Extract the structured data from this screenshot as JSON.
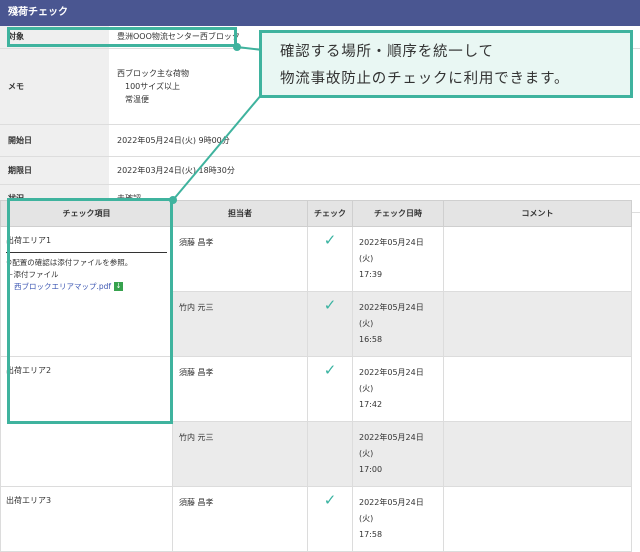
{
  "title": "殘荷チェック",
  "info": {
    "target_label": "対象",
    "target_value": "豊洲OOO物流センター西ブロック",
    "memo_label": "メモ",
    "memo_lines": [
      "西ブロック主な荷物",
      "100サイズ以上",
      "常温便"
    ],
    "start_label": "開始日",
    "start_value": "2022年05月24日(火) 9時00分",
    "due_label": "期限日",
    "due_value": "2022年03月24日(火) 18時30分",
    "status_label": "状況",
    "status_value": "未確認"
  },
  "callout": {
    "line1": "確認する場所・順序を統一して",
    "line2": "物流事故防止のチェックに利用できます。"
  },
  "table": {
    "headers": [
      "チェック項目",
      "担当者",
      "チェック",
      "チェック日時",
      "コメント"
    ],
    "check_glyph": "✓",
    "areas": [
      {
        "name": "出荷エリア1",
        "note": "※配置の確認は添付ファイルを参照。",
        "attach_label": "－添付ファイル",
        "attach_file": "西ブロックエリアマップ.pdf",
        "rows": [
          {
            "person": "須藤 昌孝",
            "checked": true,
            "date": "2022年05月24日(火)",
            "time": "17:39"
          },
          {
            "person": "竹内 元三",
            "checked": true,
            "date": "2022年05月24日(火)",
            "time": "16:58"
          }
        ]
      },
      {
        "name": "出荷エリア2",
        "rows": [
          {
            "person": "須藤 昌孝",
            "checked": true,
            "date": "2022年05月24日(火)",
            "time": "17:42"
          },
          {
            "person": "竹内 元三",
            "checked": false,
            "date": "2022年05月24日(火)",
            "time": "17:00"
          }
        ]
      },
      {
        "name": "出荷エリア3",
        "rows": [
          {
            "person": "須藤 昌孝",
            "checked": true,
            "date": "2022年05月24日(火)",
            "time": "17:58"
          }
        ]
      }
    ]
  },
  "colors": {
    "header": "#4a5691",
    "accent": "#3fb39e",
    "callout_bg": "#e9f7f3"
  }
}
